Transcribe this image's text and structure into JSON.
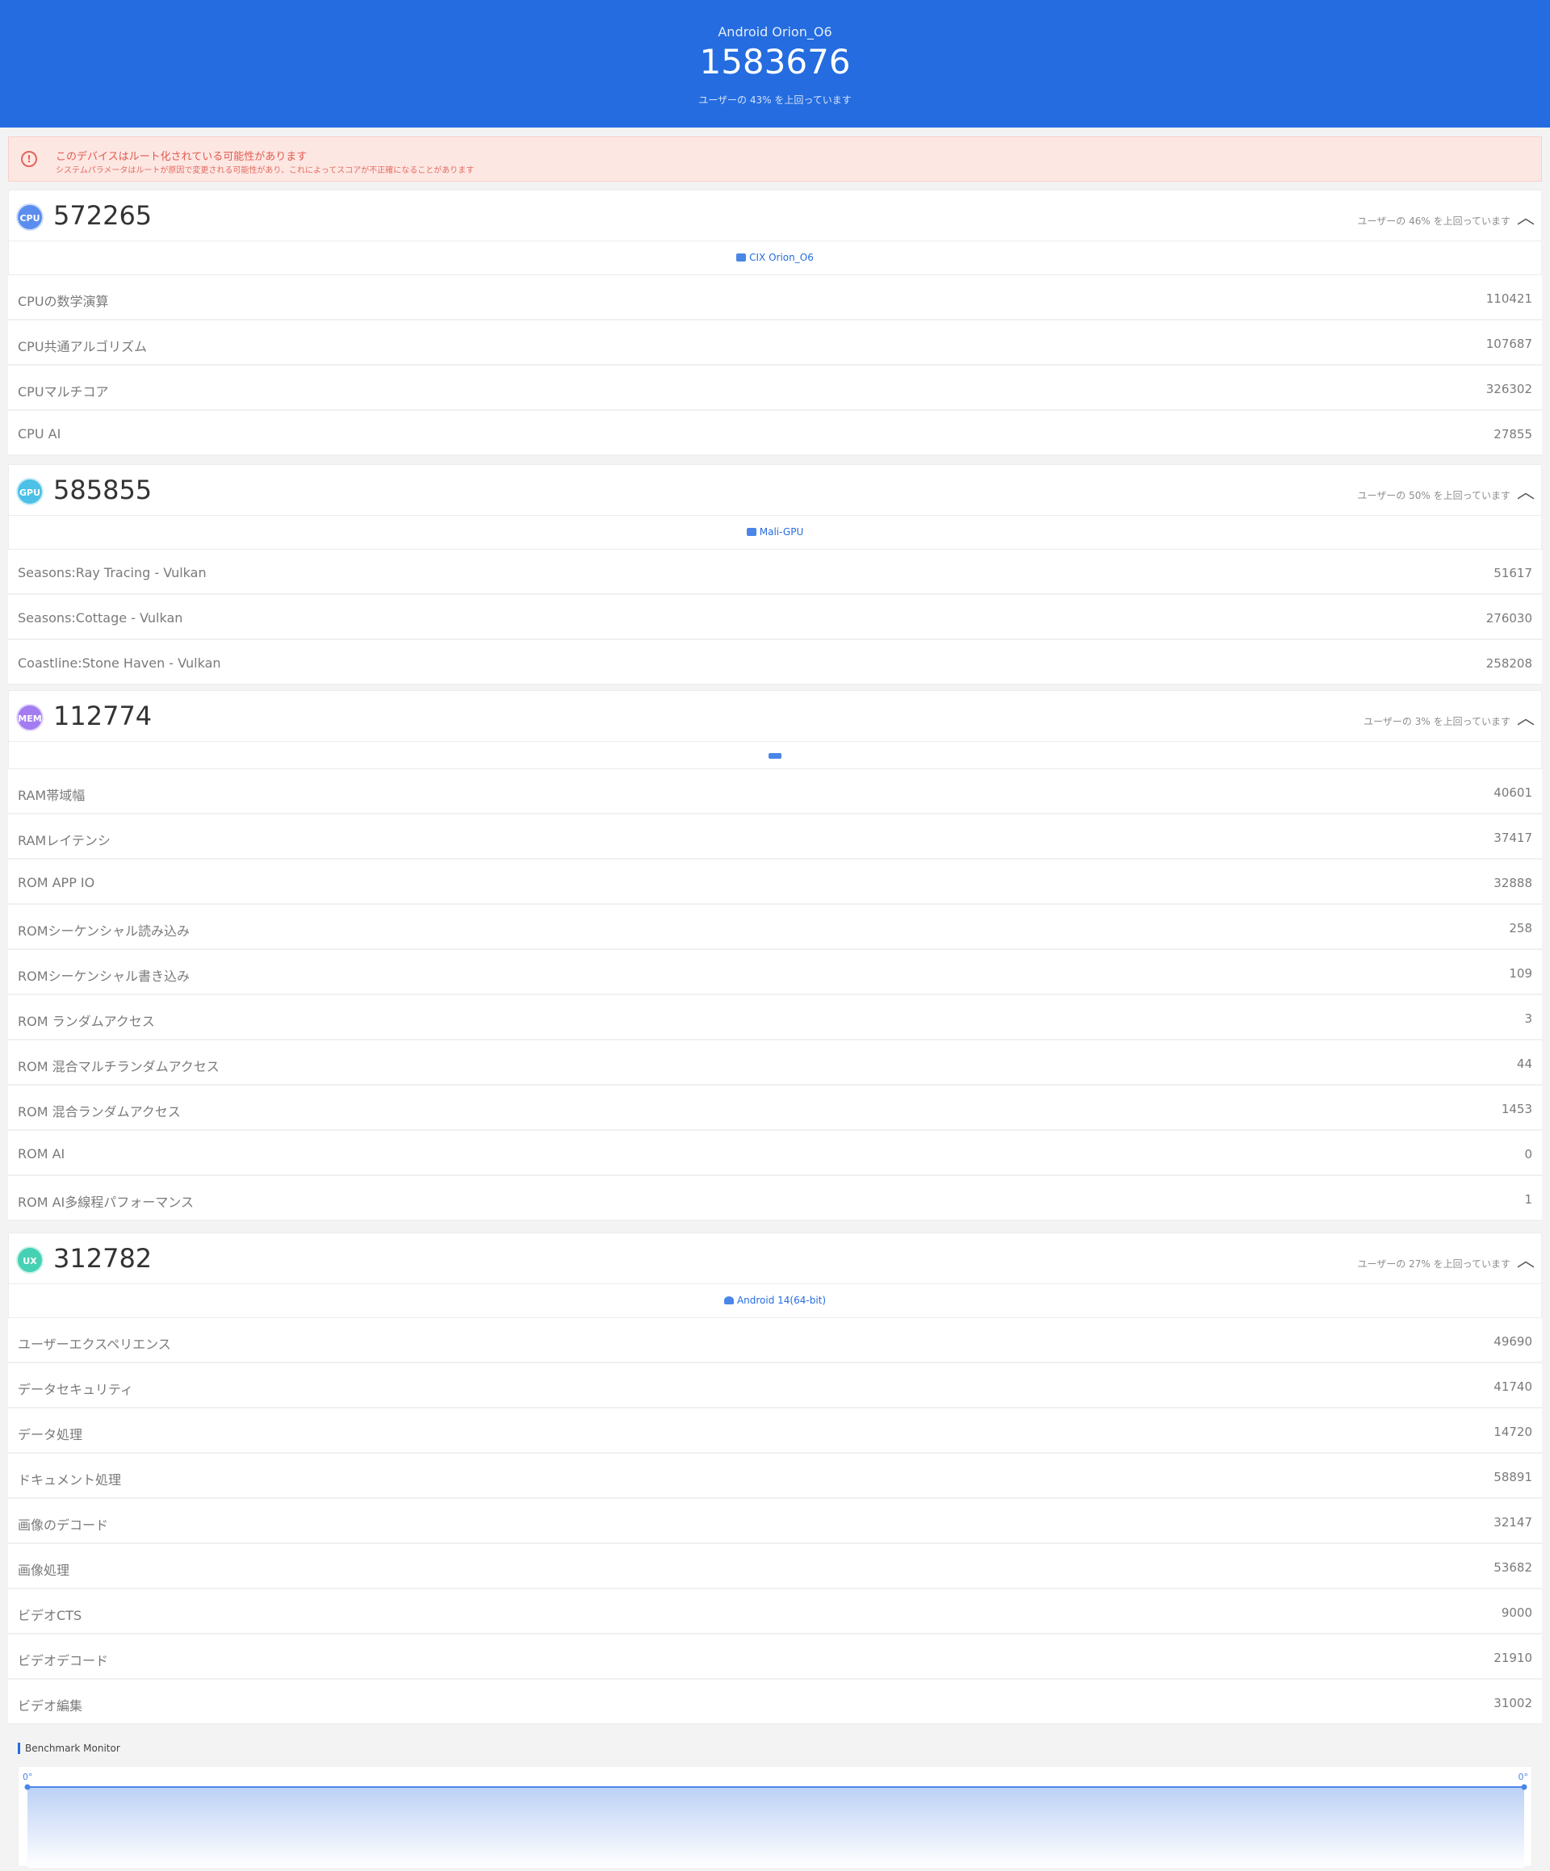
{
  "header": {
    "device": "Android Orion_O6",
    "total_score": "1583676",
    "rank": "ユーザーの 43% を上回っています"
  },
  "warning": {
    "title": "このデバイスはルート化されている可能性があります",
    "detail": "システムパラメータはルートが原因で変更される可能性があり、これによってスコアが不正確になることがあります"
  },
  "cpu": {
    "badge": "CPU",
    "score": "572265",
    "rank": "ユーザーの 46% を上回っています",
    "chip": "CIX Orion_O6",
    "rows": [
      {
        "label": "CPUの数学演算",
        "value": "110421"
      },
      {
        "label": "CPU共通アルゴリズム",
        "value": "107687"
      },
      {
        "label": "CPUマルチコア",
        "value": "326302"
      },
      {
        "label": "CPU AI",
        "value": "27855"
      }
    ]
  },
  "gpu": {
    "badge": "GPU",
    "score": "585855",
    "rank": "ユーザーの 50% を上回っています",
    "chip": "Mali-GPU",
    "rows": [
      {
        "label": "Seasons:Ray Tracing - Vulkan",
        "value": "51617"
      },
      {
        "label": "Seasons:Cottage - Vulkan",
        "value": "276030"
      },
      {
        "label": "Coastline:Stone Haven - Vulkan",
        "value": "258208"
      }
    ]
  },
  "mem": {
    "badge": "MEM",
    "score": "112774",
    "rank": "ユーザーの 3% を上回っています",
    "rows": [
      {
        "label": "RAM帯域幅",
        "value": "40601"
      },
      {
        "label": "RAMレイテンシ",
        "value": "37417"
      },
      {
        "label": "ROM APP IO",
        "value": "32888"
      },
      {
        "label": "ROMシーケンシャル読み込み",
        "value": "258"
      },
      {
        "label": "ROMシーケンシャル書き込み",
        "value": "109"
      },
      {
        "label": "ROM ランダムアクセス",
        "value": "3"
      },
      {
        "label": "ROM 混合マルチランダムアクセス",
        "value": "44"
      },
      {
        "label": "ROM 混合ランダムアクセス",
        "value": "1453"
      },
      {
        "label": "ROM AI",
        "value": "0"
      },
      {
        "label": "ROM AI多線程パフォーマンス",
        "value": "1"
      }
    ]
  },
  "ux": {
    "badge": "UX",
    "score": "312782",
    "rank": "ユーザーの 27% を上回っています",
    "chip": "Android 14(64-bit)",
    "rows": [
      {
        "label": "ユーザーエクスペリエンス",
        "value": "49690"
      },
      {
        "label": "データセキュリティ",
        "value": "41740"
      },
      {
        "label": "データ処理",
        "value": "14720"
      },
      {
        "label": "ドキュメント処理",
        "value": "58891"
      },
      {
        "label": "画像のデコード",
        "value": "32147"
      },
      {
        "label": "画像処理",
        "value": "53682"
      },
      {
        "label": "ビデオCTS",
        "value": "9000"
      },
      {
        "label": "ビデオデコード",
        "value": "21910"
      },
      {
        "label": "ビデオ編集",
        "value": "31002"
      }
    ]
  },
  "monitor": {
    "title": "Benchmark Monitor",
    "left_temp": "0°",
    "right_temp": "0°"
  },
  "colors": {
    "header": "#246ce0",
    "cpu": "#5b8def",
    "gpu": "#4cc0e6",
    "mem": "#a27cf0",
    "ux": "#45d1b3"
  }
}
